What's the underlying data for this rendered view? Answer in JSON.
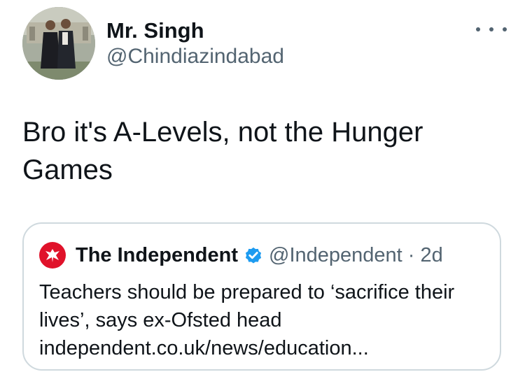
{
  "author": {
    "name": "Mr. Singh",
    "handle": "@Chindiazindabad"
  },
  "menu": {
    "icon": "more-options-icon"
  },
  "tweet": {
    "text": "Bro it's A-Levels, not the Hunger Games"
  },
  "quote": {
    "name": "The Independent",
    "handle_time": "@Independent · 2d",
    "text": "Teachers should be prepared to ‘sacrifice their lives’, says ex-Ofsted head independent.co.uk/news/education...",
    "logo_icon": "eagle-logo-icon",
    "verified_icon": "verified-badge-icon"
  },
  "colors": {
    "text": "#0f1419",
    "secondary": "#536471",
    "border": "#cfd9de",
    "verified": "#1d9bf0",
    "brand_red": "#e0122a"
  }
}
